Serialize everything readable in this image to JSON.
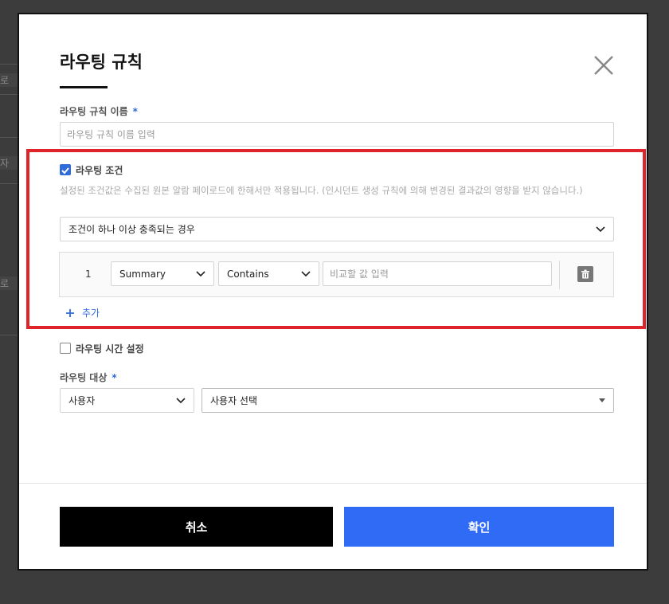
{
  "background": {
    "fragments": [
      "로",
      "자",
      "로"
    ]
  },
  "modal": {
    "title": "라우팅 규칙",
    "rule_name": {
      "label": "라우팅 규칙 이름",
      "required_mark": "*",
      "placeholder": "라우팅 규칙 이름 입력"
    },
    "condition": {
      "checkbox_label": "라우팅 조건",
      "checked": true,
      "description": "설정된 조건값은 수집된 원본 알람 페이로드에 한해서만 적용됩니다. (인시던트 생성 규칙에 의해 변경된 결과값의 영향을 받지 않습니다.)",
      "match_select": "조건이 하나 이상 충족되는 경우",
      "rows": [
        {
          "index": "1",
          "field": "Summary",
          "operator": "Contains",
          "value_placeholder": "비교할 값 입력"
        }
      ],
      "add_label": "추가"
    },
    "time_setting": {
      "checkbox_label": "라우팅 시간 설정",
      "checked": false
    },
    "target": {
      "label": "라우팅 대상",
      "required_mark": "*",
      "type_select": "사용자",
      "user_select": "사용자 선택"
    },
    "buttons": {
      "cancel": "취소",
      "confirm": "확인"
    }
  },
  "colors": {
    "accent": "#2f6bf5",
    "highlight": "#e0242b",
    "cancel_bg": "#000000"
  }
}
